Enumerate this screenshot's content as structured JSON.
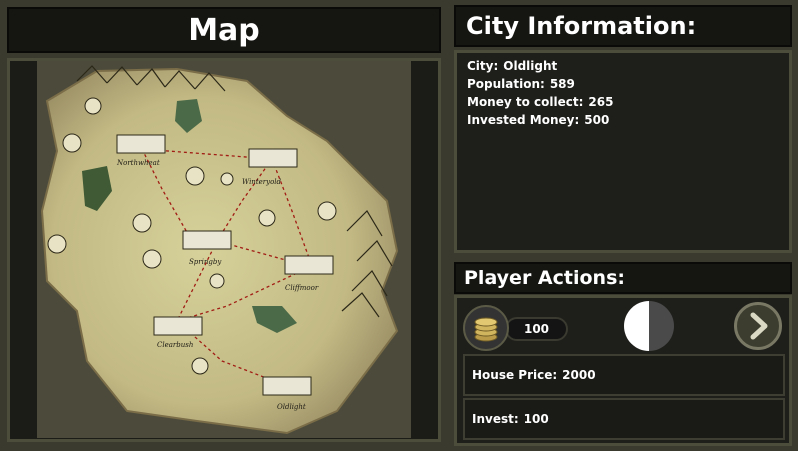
{
  "map_section": {
    "title": "Map",
    "cities": [
      {
        "name": "Northwheat"
      },
      {
        "name": "Winteryold"
      },
      {
        "name": "Springby"
      },
      {
        "name": "Cliffmoor"
      },
      {
        "name": "Clearbush"
      },
      {
        "name": "Oldlight"
      }
    ]
  },
  "city_info": {
    "title": "City Information:",
    "city_label": "City:",
    "city_value": "Oldlight",
    "population_label": "Population:",
    "population_value": "589",
    "money_label": "Money to collect:",
    "money_value": "265",
    "invested_label": "Invested Money:",
    "invested_value": "500"
  },
  "player_actions": {
    "title": "Player Actions:",
    "money_amount": "100",
    "house_price_label": "House Price:",
    "house_price_value": "2000",
    "invest_label": "Invest:",
    "invest_value": "100"
  },
  "icons": {
    "coins": "coins-icon",
    "toggle": "day-night-toggle-icon",
    "next": "chevron-right-icon"
  },
  "colors": {
    "panel_border": "#4d4d3c",
    "panel_bg": "#1e1e1b",
    "map_parchment": "#c9c290",
    "road": "#a11c14"
  }
}
